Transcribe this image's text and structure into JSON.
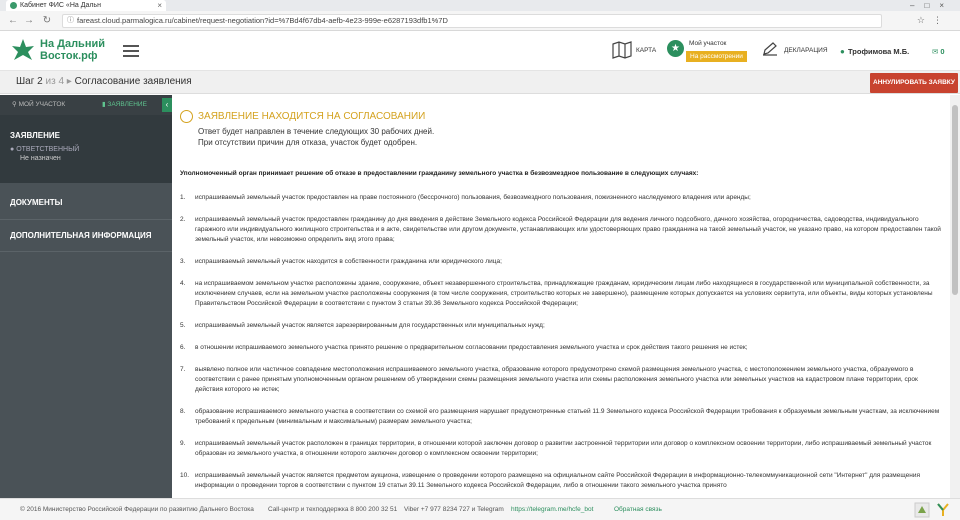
{
  "browser": {
    "tab_title": "Кабинет ФИС «На Дальн",
    "url": "fareast.cloud.parmalogica.ru/cabinet/request-negotiation?id=%7Bd4f67db4-aefb-4e23-999e-e6287193dfb1%7D"
  },
  "header": {
    "logo_line1": "На Дальний",
    "logo_line2": "Восток.рф",
    "map_label": "КАРТА",
    "myplot_label": "Мой участок",
    "myplot_status": "На рассмотрении",
    "declaration_label": "ДЕКЛАРАЦИЯ",
    "user_name": "Трофимова М.Б.",
    "messages_count": "0"
  },
  "stepbar": {
    "step_word": "Шаг",
    "step_current": "2",
    "step_of": "из 4",
    "step_title": "Согласование заявления",
    "cancel_button": "АННУЛИРОВАТЬ ЗАЯВКУ"
  },
  "sidebar": {
    "tab_myplot": "МОЙ УЧАСТОК",
    "tab_application": "ЗАЯВЛЕНИЕ",
    "section_application": "ЗАЯВЛЕНИЕ",
    "responsible_label": "ОТВЕТСТВЕННЫЙ",
    "responsible_value": "Не назначен",
    "section_documents": "ДОКУМЕНТЫ",
    "section_additional": "ДОПОЛНИТЕЛЬНАЯ ИНФОРМАЦИЯ"
  },
  "notice": {
    "title": "ЗАЯВЛЕНИЕ НАХОДИТСЯ НА СОГЛАСОВАНИИ",
    "line1": "Ответ будет направлен в течение следующих 30 рабочих дней.",
    "line2": "При отсутствии причин для отказа, участок будет одобрен."
  },
  "intro": "Уполномоченный орган принимает решение об отказе в предоставлении гражданину земельного участка в безвозмездное пользование в следующих случаях:",
  "reasons": [
    {
      "num": "1.",
      "text": "испрашиваемый земельный участок предоставлен на праве постоянного (бессрочного) пользования, безвозмездного пользования, пожизненного наследуемого владения или аренды;"
    },
    {
      "num": "2.",
      "text": "испрашиваемый земельный участок предоставлен гражданину до дня введения в действие Земельного кодекса Российской Федерации для ведения личного подсобного, дачного хозяйства, огородничества, садоводства, индивидуального гаражного или индивидуального жилищного строительства и в акте, свидетельстве или другом документе, устанавливающих или удостоверяющих право гражданина на такой земельный участок, не указано право, на котором предоставлен такой земельный участок, или невозможно определить вид этого права;"
    },
    {
      "num": "3.",
      "text": "испрашиваемый земельный участок находится в собственности гражданина или юридического лица;"
    },
    {
      "num": "4.",
      "text": "на испрашиваемом земельном участке расположены здание, сооружение, объект незавершенного строительства, принадлежащие гражданам, юридическим лицам либо находящиеся в государственной или муниципальной собственности, за исключением случаев, если на земельном участке расположены сооружения (в том числе сооружения, строительство которых не завершено), размещение которых допускается на условиях сервитута, или объекты, виды которых установлены Правительством Российской Федерации в соответствии с пунктом 3 статьи 39.36 Земельного кодекса Российской Федерации;"
    },
    {
      "num": "5.",
      "text": "испрашиваемый земельный участок является зарезервированным для государственных или муниципальных нужд;"
    },
    {
      "num": "6.",
      "text": "в отношении испрашиваемого земельного участка принято решение о предварительном согласовании предоставления земельного участка и срок действия такого решения не истек;"
    },
    {
      "num": "7.",
      "text": "выявлено полное или частичное совпадение местоположения испрашиваемого земельного участка, образование которого предусмотрено схемой размещения земельного участка, с местоположением земельного участка, образуемого в соответствии с ранее принятым уполномоченным органом решением об утверждении схемы размещения земельного участка или схемы расположения земельного участка или земельных участков на кадастровом плане территории, срок действия которого не истек;"
    },
    {
      "num": "8.",
      "text": "образование испрашиваемого земельного участка в соответствии со схемой его размещения нарушает предусмотренные статьей 11.9 Земельного кодекса Российской Федерации требования к образуемым земельным участкам, за исключением требований к предельным (минимальным и максимальным) размерам земельного участка;"
    },
    {
      "num": "9.",
      "text": "испрашиваемый земельный участок расположен в границах территории, в отношении которой заключен договор о развитии застроенной территории или договор о комплексном освоении территории, либо испрашиваемый земельный участок образован из земельного участка, в отношении которого заключен договор о комплексном освоении территории;"
    },
    {
      "num": "10.",
      "text": "испрашиваемый земельный участок является предметом аукциона, извещение о проведении которого размещено на официальном сайте Российской Федерации в информационно-телекоммуникационной сети \"Интернет\" для размещения информации о проведении торгов в соответствии с пунктом 19 статьи 39.11 Земельного кодекса Российской Федерации, либо в отношении такого земельного участка принято"
    }
  ],
  "footer": {
    "copyright": "© 2016 Министерство Российской Федерации по развитию Дальнего Востока",
    "callcenter": "Call-центр и техподдержка 8 800 200 32 51",
    "messengers": "Viber +7 977 8234 727 и Telegram",
    "telegram_link": "https://telegram.me/hcfe_bot",
    "feedback": "Обратная связь"
  },
  "colors": {
    "brand_green": "#2c8f5e",
    "warning_gold": "#d4a21f",
    "danger_red": "#c8432f",
    "sidebar_bg": "#4a5257"
  }
}
